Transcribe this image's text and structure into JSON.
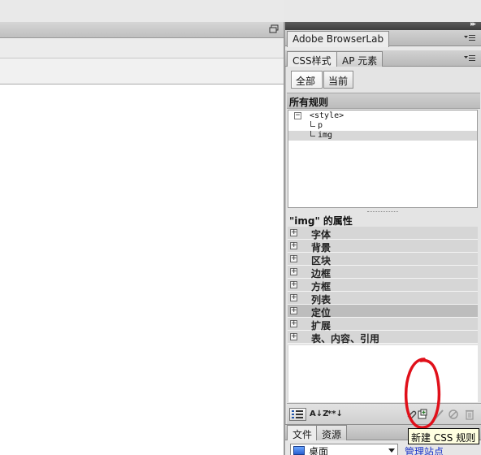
{
  "panels": {
    "browserlab_tab": "Adobe BrowserLab",
    "css_tabs": [
      "CSS样式",
      "AP 元素"
    ],
    "files_tabs": [
      "文件",
      "资源"
    ]
  },
  "css_panel": {
    "mode_buttons": {
      "all": "全部",
      "current": "当前",
      "selected": "all"
    },
    "rules_header": "所有规则",
    "rules": [
      {
        "label": "<style>",
        "expanded": true
      },
      {
        "label": "p"
      },
      {
        "label": "img",
        "selected": true
      }
    ],
    "properties_header": "\"img\" 的属性",
    "categories": [
      {
        "label": "字体"
      },
      {
        "label": "背景"
      },
      {
        "label": "区块"
      },
      {
        "label": "边框"
      },
      {
        "label": "方框"
      },
      {
        "label": "列表"
      },
      {
        "label": "定位",
        "selected": true
      },
      {
        "label": "扩展"
      },
      {
        "label": "表、内容、引用"
      }
    ],
    "toolbar": {
      "category_view": "",
      "az_view": "A↓Z",
      "set_view": "**↓"
    }
  },
  "tooltip": "新建 CSS 规则",
  "files_panel": {
    "site_select": "桌面",
    "manage_link": "管理站点"
  },
  "glyphs": {
    "expand": "+",
    "collapse": "−",
    "panel_collapse": "▸▸"
  },
  "colors": {
    "annotation": "#e0101a",
    "link": "#1a33c9"
  }
}
